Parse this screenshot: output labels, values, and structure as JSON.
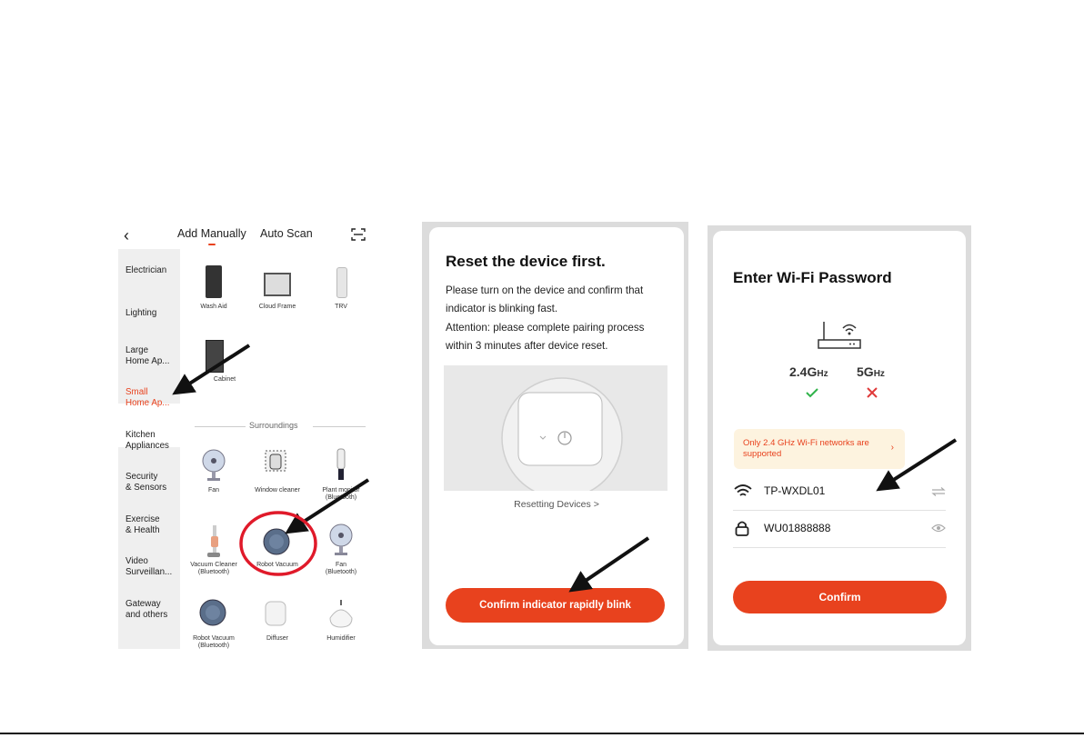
{
  "panel1": {
    "header": {
      "back_icon": "chevron-left-icon",
      "tab_add": "Add Manually",
      "tab_auto": "Auto Scan",
      "scan_icon": "scan-icon"
    },
    "sidebar": [
      "Electrician",
      "Lighting",
      "Large\nHome Ap...",
      "Small\nHome Ap...",
      "Kitchen\nAppliances",
      "Security\n& Sensors",
      "Exercise\n& Health",
      "Video\nSurveillan...",
      "Gateway\nand others"
    ],
    "active_category": "Small\nHome Ap...",
    "devices_top": [
      "Wash Aid",
      "Cloud Frame",
      "TRV",
      "Cabinet"
    ],
    "section_title": "Surroundings",
    "devices_surroundings": [
      "Fan",
      "Window cleaner",
      "Plant monitor\n(Bluetooth)",
      "Vacuum Cleaner\n(Bluetooth)",
      "Robot Vacuum",
      "Fan\n(Bluetooth)",
      "Robot Vacuum\n(Bluetooth)",
      "Diffuser",
      "Humidifier"
    ]
  },
  "panel2": {
    "title": "Reset the device first.",
    "text1": "Please turn on the device and confirm that",
    "text2": "indicator is blinking fast.",
    "text3": "Attention: please complete pairing process",
    "text4": "within 3 minutes after device reset.",
    "link": "Resetting Devices >",
    "button": "Confirm indicator rapidly blink"
  },
  "panel3": {
    "title": "Enter Wi-Fi Password",
    "band1": "2.4G",
    "band1_unit": "Hz",
    "band2": "5G",
    "band2_unit": "Hz",
    "banner": "Only 2.4 GHz Wi-Fi networks are supported",
    "banner_chevron": "›",
    "ssid": "TP-WXDL01",
    "password": "WU01888888",
    "button": "Confirm"
  },
  "colors": {
    "accent": "#e8421e",
    "ok": "#2fb34a",
    "bad": "#e03a3a",
    "banner_bg": "#fdf3df"
  }
}
